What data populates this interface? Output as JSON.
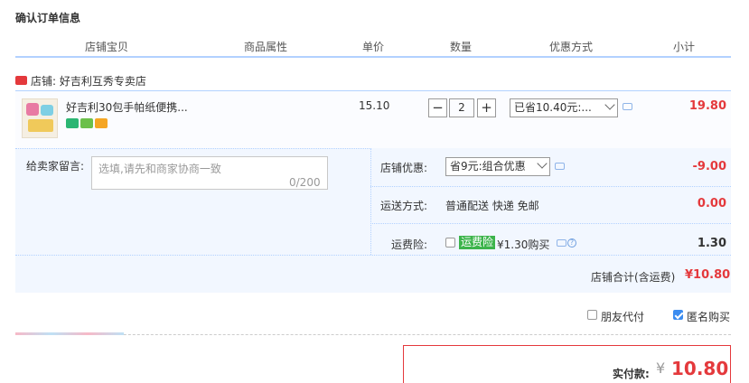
{
  "page_title": "确认订单信息",
  "columns": [
    "店铺宝贝",
    "商品属性",
    "单价",
    "数量",
    "优惠方式",
    "小计"
  ],
  "shop": {
    "label": "店铺: 好吉利互秀专卖店"
  },
  "item": {
    "name": "好吉利30包手帕纸便携...",
    "unit_price": "15.10",
    "quantity": "2",
    "minus_label": "−",
    "plus_label": "+",
    "discount_select": "已省10.40元:...",
    "subtotal": "19.80"
  },
  "message": {
    "label": "给卖家留言:",
    "placeholder": "选填,请先和商家协商一致",
    "count": "0/200"
  },
  "shop_discount": {
    "label": "店铺优惠:",
    "select": "省9元:组合优惠",
    "value": "-9.00"
  },
  "shipping": {
    "label": "运送方式:",
    "method": "普通配送 快递 免邮",
    "value": "0.00"
  },
  "insurance": {
    "label": "运费险:",
    "tag": "运费险",
    "price_text": "¥1.30购买",
    "value": "1.30"
  },
  "shop_total": {
    "label": "店铺合计(含运费)",
    "value": "¥10.80"
  },
  "options": {
    "friend_pay": "朋友代付",
    "anonymous": "匿名购买"
  },
  "payment": {
    "label": "实付款:",
    "currency": "¥",
    "amount": "10.80"
  },
  "colors": {
    "price_red": "#e4393c",
    "accent_blue": "#b2d1ff",
    "insurance_green": "#3cb44b"
  }
}
